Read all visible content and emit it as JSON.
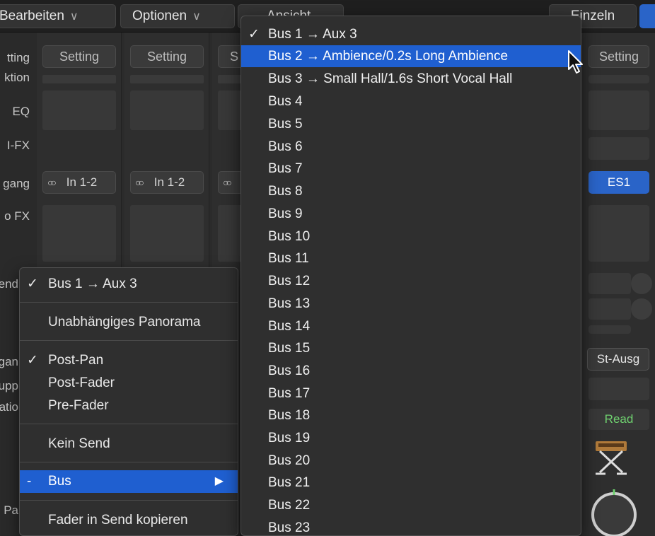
{
  "menubar": {
    "bearbeiten": "Bearbeiten",
    "optionen": "Optionen",
    "ansicht": "Ansicht",
    "einzeln": "Einzeln",
    "chevron": "∨"
  },
  "labels": {
    "setting": "tting",
    "funktion": "ktion",
    "eq": "EQ",
    "midi_fx": "I-FX",
    "eingang": "gang",
    "audio_fx": "o FX",
    "sends": "end",
    "ausgang": "gan",
    "gruppe": "upp",
    "automation": "atio",
    "pan": "Pa"
  },
  "strips": [
    {
      "setting": "Setting",
      "input": "In 1-2",
      "input_icon": "stereo-rings-icon"
    },
    {
      "setting": "Setting",
      "input": "In 1-2",
      "input_icon": "stereo-rings-icon"
    },
    {
      "setting": "S",
      "input": "",
      "input_icon": "stereo-rings-icon"
    }
  ],
  "right_strip": {
    "setting": "Setting",
    "instrument": "ES1",
    "output": "St-Ausg",
    "automation": "Read",
    "colors": {
      "instrument_bg": "#2a64c8",
      "automation_text": "#6fd16f"
    }
  },
  "send_menu": {
    "items": [
      {
        "check": "✓",
        "label": "Bus 1 → Aux 3"
      },
      {
        "check": "",
        "label": "Unabhängiges Panorama"
      },
      {
        "check": "✓",
        "label": "Post-Pan"
      },
      {
        "check": "",
        "label": "Post-Fader"
      },
      {
        "check": "",
        "label": "Pre-Fader"
      },
      {
        "check": "",
        "label": "Kein Send"
      },
      {
        "check": "-",
        "label": "Bus",
        "submenu_arrow": "▶"
      },
      {
        "check": "",
        "label": "Fader in Send kopieren"
      }
    ]
  },
  "bus_menu": {
    "items": [
      {
        "check": "✓",
        "label": "Bus 1 → Aux 3"
      },
      {
        "check": "",
        "label": "Bus 2 → Ambience/0.2s Long Ambience",
        "selected": true
      },
      {
        "check": "",
        "label": "Bus 3 → Small Hall/1.6s Short Vocal Hall"
      },
      {
        "check": "",
        "label": "Bus 4"
      },
      {
        "check": "",
        "label": "Bus 5"
      },
      {
        "check": "",
        "label": "Bus 6"
      },
      {
        "check": "",
        "label": "Bus 7"
      },
      {
        "check": "",
        "label": "Bus 8"
      },
      {
        "check": "",
        "label": "Bus 9"
      },
      {
        "check": "",
        "label": "Bus 10"
      },
      {
        "check": "",
        "label": "Bus 11"
      },
      {
        "check": "",
        "label": "Bus 12"
      },
      {
        "check": "",
        "label": "Bus 13"
      },
      {
        "check": "",
        "label": "Bus 14"
      },
      {
        "check": "",
        "label": "Bus 15"
      },
      {
        "check": "",
        "label": "Bus 16"
      },
      {
        "check": "",
        "label": "Bus 17"
      },
      {
        "check": "",
        "label": "Bus 18"
      },
      {
        "check": "",
        "label": "Bus 19"
      },
      {
        "check": "",
        "label": "Bus 20"
      },
      {
        "check": "",
        "label": "Bus 21"
      },
      {
        "check": "",
        "label": "Bus 22"
      },
      {
        "check": "",
        "label": "Bus 23"
      }
    ],
    "colors": {
      "highlight": "#1f5fd0"
    }
  }
}
